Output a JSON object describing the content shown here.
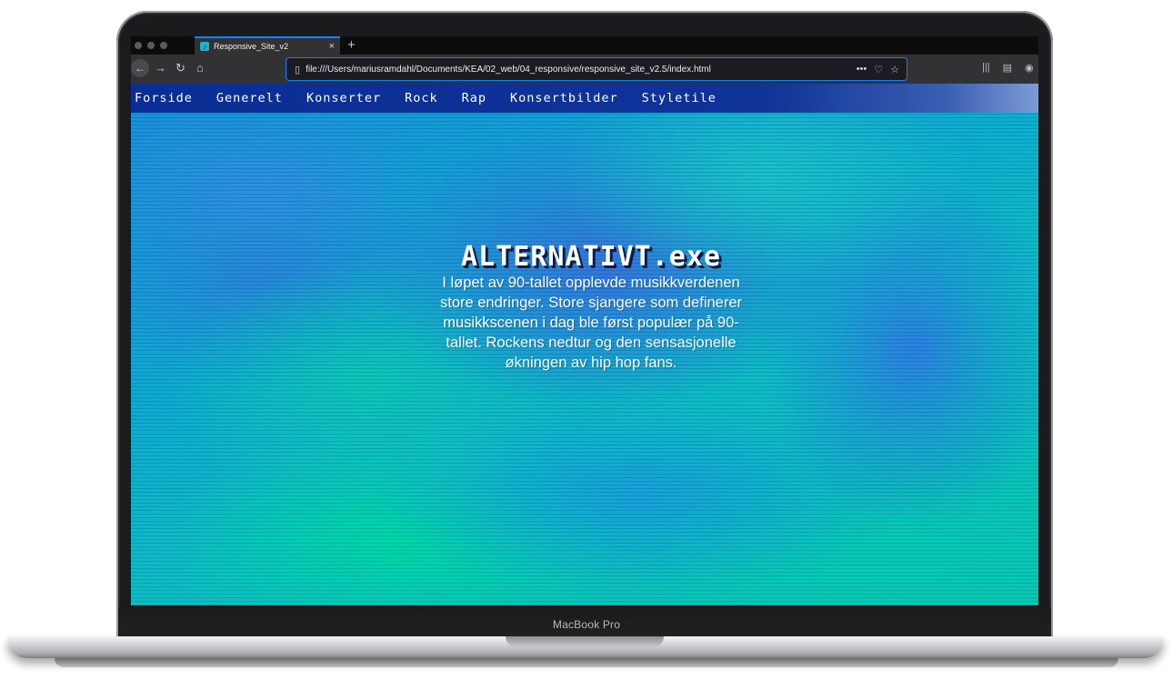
{
  "device": {
    "label": "MacBook Pro"
  },
  "browser": {
    "tab": {
      "title": "Responsive_Site_v2"
    },
    "url": "file:///Users/mariusramdahl/Documents/KEA/02_web/04_responsive/responsive_site_v2.5/index.html"
  },
  "site": {
    "nav": [
      "Forside",
      "Generelt",
      "Konserter",
      "Rock",
      "Rap",
      "Konsertbilder",
      "Styletile"
    ],
    "hero": {
      "title": "ALTERNATIVT.exe",
      "text": "I løpet av 90-tallet opplevde musikkverdenen store endringer. Store sjangere som definerer musikkscenen i dag ble først populær på 90-tallet. Rockens nedtur og den sensasjonelle økningen av hip hop fans."
    }
  }
}
